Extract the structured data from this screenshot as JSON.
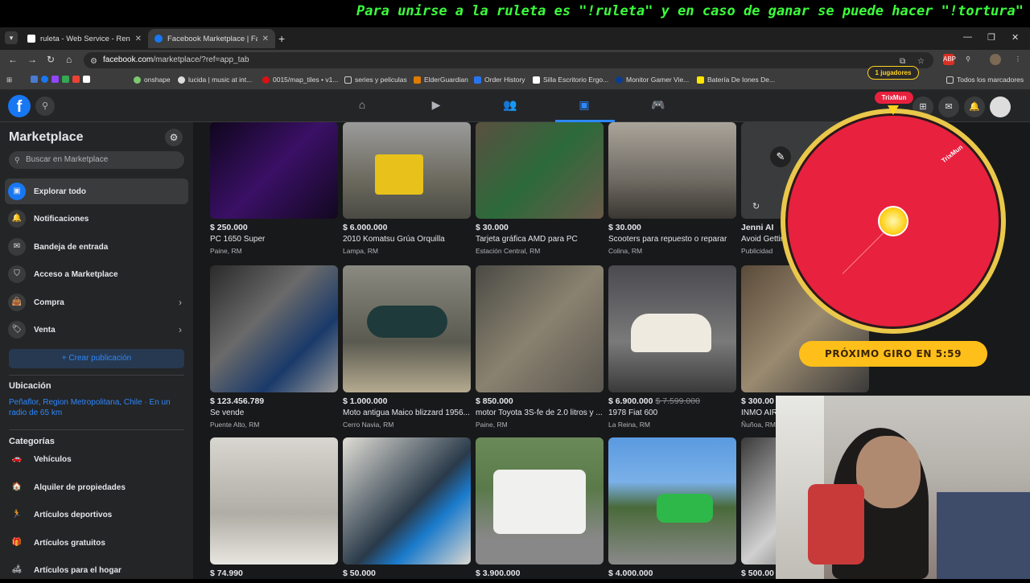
{
  "overlay": {
    "banner": "Para unirse a la ruleta es \"!ruleta\" y en caso de ganar se puede hacer \"!tortura\"",
    "players": "1 jugadores",
    "wheel_player": "TrixMun",
    "pointer_label": "TrixMun",
    "next_spin": "PRÓXIMO GIRO EN 5:59"
  },
  "browser": {
    "tabs": [
      {
        "label": "ruleta - Web Service - Render D",
        "close": "✕"
      },
      {
        "label": "Facebook Marketplace | Facebo",
        "close": "✕"
      }
    ],
    "new_tab": "+",
    "url_host": "facebook.com",
    "url_path": "/marketplace/?ref=app_tab",
    "bookmarks": [
      "onshape",
      "lucida | music at int...",
      "0015/map_tiles • v1...",
      "series y peliculas",
      "ElderGuardian",
      "Order History",
      "Silla Escritorio Ergo...",
      "Monitor Gamer Vie...",
      "Batería De Iones De..."
    ],
    "all_bookmarks": "Todos los marcadores"
  },
  "fb": {
    "logo": "f"
  },
  "sidebar": {
    "title": "Marketplace",
    "search_placeholder": "Buscar en Marketplace",
    "items": [
      {
        "label": "Explorar todo"
      },
      {
        "label": "Notificaciones"
      },
      {
        "label": "Bandeja de entrada"
      },
      {
        "label": "Acceso a Marketplace"
      },
      {
        "label": "Compra"
      },
      {
        "label": "Venta"
      }
    ],
    "create_label": "+ Crear publicación",
    "location_heading": "Ubicación",
    "location_text": "Peñaflor, Region Metropolitana, Chile · En un radio de 65 km",
    "categories_heading": "Categorías",
    "categories": [
      {
        "label": "Vehículos"
      },
      {
        "label": "Alquiler de propiedades"
      },
      {
        "label": "Artículos deportivos"
      },
      {
        "label": "Artículos gratuitos"
      },
      {
        "label": "Artículos para el hogar"
      }
    ]
  },
  "listings": {
    "row1": [
      {
        "price": "$ 250.000",
        "title": "PC 1650 Super",
        "location": "Paine, RM"
      },
      {
        "price": "$ 6.000.000",
        "title": "2010 Komatsu Grúa Orquilla",
        "location": "Lampa, RM"
      },
      {
        "price": "$ 30.000",
        "title": "Tarjeta gráfica AMD para PC",
        "location": "Estación Central, RM"
      },
      {
        "price": "$ 30.000",
        "title": "Scooters para repuesto o reparar",
        "location": "Colina, RM"
      },
      {
        "price": "Jenni AI",
        "title": "Avoid Getting",
        "location": "Publicidad"
      }
    ],
    "row2": [
      {
        "price": "$ 123.456.789",
        "title": "Se vende",
        "location": "Puente Alto, RM"
      },
      {
        "price": "$ 1.000.000",
        "title": "Moto antigua Maico blizzard 1956...",
        "location": "Cerro Navia, RM"
      },
      {
        "price": "$ 850.000",
        "title": "motor Toyota 3S-fe de 2.0 litros y ...",
        "location": "Paine, RM"
      },
      {
        "price": "$ 6.900.000",
        "old_price": "$ 7.599.000",
        "title": "1978 Fiat 600",
        "location": "La Reina, RM"
      },
      {
        "price": "$ 300.00",
        "title": "INMO AIR",
        "location": "Ñuñoa, RM"
      }
    ],
    "row3": [
      {
        "price": "$ 74.990"
      },
      {
        "price": "$ 50.000"
      },
      {
        "price": "$ 3.900.000"
      },
      {
        "price": "$ 4.000.000"
      },
      {
        "price": "$ 500.00"
      }
    ]
  }
}
